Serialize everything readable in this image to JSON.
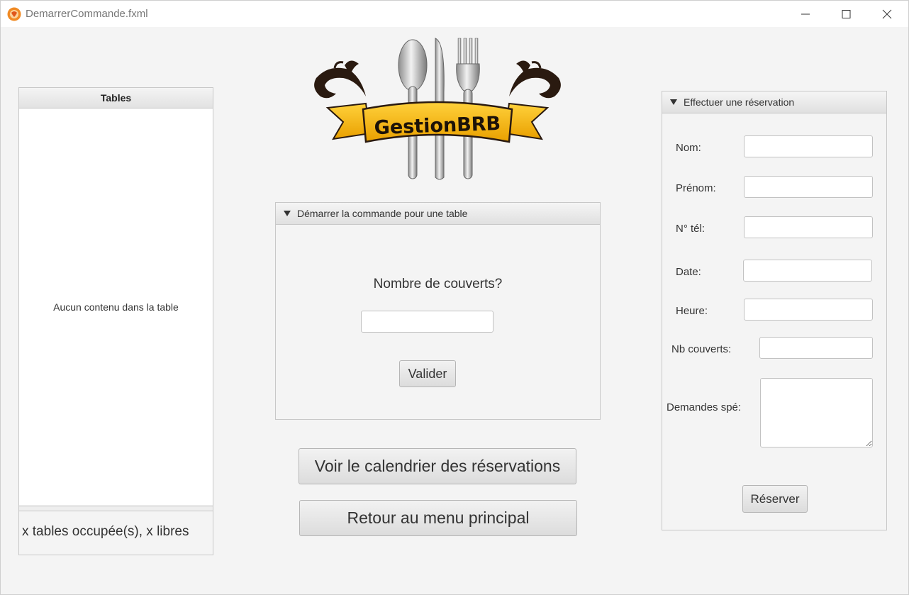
{
  "window": {
    "title": "DemarrerCommande.fxml"
  },
  "tables_panel": {
    "header": "Tables",
    "empty_message": "Aucun contenu dans la table",
    "status": "x tables occupée(s), x libres"
  },
  "logo": {
    "text": "GestionBRB"
  },
  "command_pane": {
    "title": "Démarrer la commande pour une table",
    "question": "Nombre de couverts?",
    "covers_value": "",
    "validate_label": "Valider"
  },
  "actions": {
    "calendar_label": "Voir le calendrier des réservations",
    "back_label": "Retour au menu principal"
  },
  "reservation_pane": {
    "title": "Effectuer une réservation",
    "fields": {
      "nom": {
        "label": "Nom:",
        "value": ""
      },
      "prenom": {
        "label": "Prénom:",
        "value": ""
      },
      "tel": {
        "label": "N° tél:",
        "value": ""
      },
      "date": {
        "label": "Date:",
        "value": ""
      },
      "heure": {
        "label": "Heure:",
        "value": ""
      },
      "couverts": {
        "label": "Nb couverts:",
        "value": ""
      },
      "demandes": {
        "label": "Demandes spé:",
        "value": ""
      }
    },
    "submit_label": "Réserver"
  },
  "colors": {
    "banner": "#f3b400",
    "window_bg": "#f4f4f4",
    "icon_accent": "#f08a24"
  }
}
